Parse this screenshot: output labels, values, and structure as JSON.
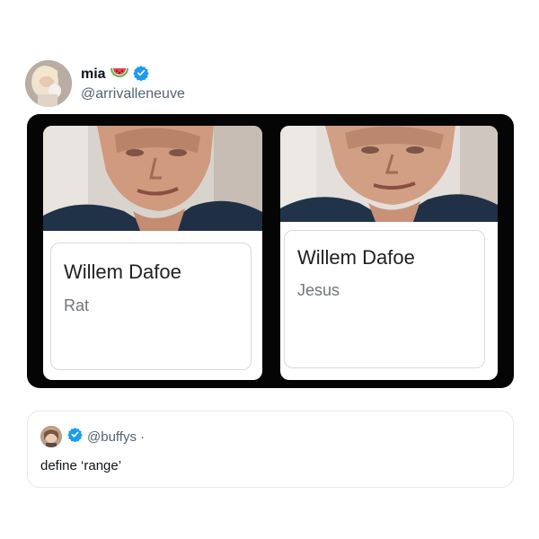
{
  "tweet": {
    "display_name": "mia",
    "handle": "@arrivalleneuve",
    "emoji": "watermelon-icon",
    "verified_color": "#1d9bf0"
  },
  "meme": {
    "cards": [
      {
        "name": "Willem Dafoe",
        "description": "Rat"
      },
      {
        "name": "Willem Dafoe",
        "description": "Jesus"
      }
    ]
  },
  "reply": {
    "handle": "@buffys ·",
    "text": "define ‘range’"
  }
}
